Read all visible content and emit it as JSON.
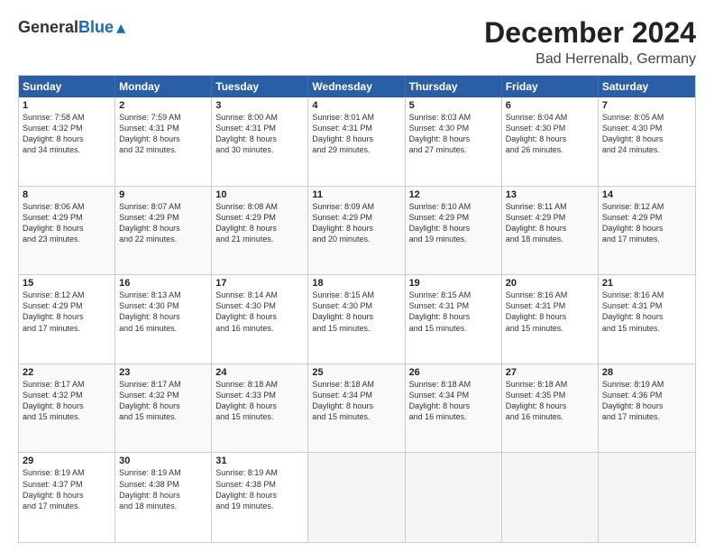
{
  "header": {
    "logo_general": "General",
    "logo_blue": "Blue",
    "title": "December 2024",
    "subtitle": "Bad Herrenalb, Germany"
  },
  "weekdays": [
    "Sunday",
    "Monday",
    "Tuesday",
    "Wednesday",
    "Thursday",
    "Friday",
    "Saturday"
  ],
  "weeks": [
    [
      {
        "day": "1",
        "detail": "Sunrise: 7:58 AM\nSunset: 4:32 PM\nDaylight: 8 hours\nand 34 minutes."
      },
      {
        "day": "2",
        "detail": "Sunrise: 7:59 AM\nSunset: 4:31 PM\nDaylight: 8 hours\nand 32 minutes."
      },
      {
        "day": "3",
        "detail": "Sunrise: 8:00 AM\nSunset: 4:31 PM\nDaylight: 8 hours\nand 30 minutes."
      },
      {
        "day": "4",
        "detail": "Sunrise: 8:01 AM\nSunset: 4:31 PM\nDaylight: 8 hours\nand 29 minutes."
      },
      {
        "day": "5",
        "detail": "Sunrise: 8:03 AM\nSunset: 4:30 PM\nDaylight: 8 hours\nand 27 minutes."
      },
      {
        "day": "6",
        "detail": "Sunrise: 8:04 AM\nSunset: 4:30 PM\nDaylight: 8 hours\nand 26 minutes."
      },
      {
        "day": "7",
        "detail": "Sunrise: 8:05 AM\nSunset: 4:30 PM\nDaylight: 8 hours\nand 24 minutes."
      }
    ],
    [
      {
        "day": "8",
        "detail": "Sunrise: 8:06 AM\nSunset: 4:29 PM\nDaylight: 8 hours\nand 23 minutes."
      },
      {
        "day": "9",
        "detail": "Sunrise: 8:07 AM\nSunset: 4:29 PM\nDaylight: 8 hours\nand 22 minutes."
      },
      {
        "day": "10",
        "detail": "Sunrise: 8:08 AM\nSunset: 4:29 PM\nDaylight: 8 hours\nand 21 minutes."
      },
      {
        "day": "11",
        "detail": "Sunrise: 8:09 AM\nSunset: 4:29 PM\nDaylight: 8 hours\nand 20 minutes."
      },
      {
        "day": "12",
        "detail": "Sunrise: 8:10 AM\nSunset: 4:29 PM\nDaylight: 8 hours\nand 19 minutes."
      },
      {
        "day": "13",
        "detail": "Sunrise: 8:11 AM\nSunset: 4:29 PM\nDaylight: 8 hours\nand 18 minutes."
      },
      {
        "day": "14",
        "detail": "Sunrise: 8:12 AM\nSunset: 4:29 PM\nDaylight: 8 hours\nand 17 minutes."
      }
    ],
    [
      {
        "day": "15",
        "detail": "Sunrise: 8:12 AM\nSunset: 4:29 PM\nDaylight: 8 hours\nand 17 minutes."
      },
      {
        "day": "16",
        "detail": "Sunrise: 8:13 AM\nSunset: 4:30 PM\nDaylight: 8 hours\nand 16 minutes."
      },
      {
        "day": "17",
        "detail": "Sunrise: 8:14 AM\nSunset: 4:30 PM\nDaylight: 8 hours\nand 16 minutes."
      },
      {
        "day": "18",
        "detail": "Sunrise: 8:15 AM\nSunset: 4:30 PM\nDaylight: 8 hours\nand 15 minutes."
      },
      {
        "day": "19",
        "detail": "Sunrise: 8:15 AM\nSunset: 4:31 PM\nDaylight: 8 hours\nand 15 minutes."
      },
      {
        "day": "20",
        "detail": "Sunrise: 8:16 AM\nSunset: 4:31 PM\nDaylight: 8 hours\nand 15 minutes."
      },
      {
        "day": "21",
        "detail": "Sunrise: 8:16 AM\nSunset: 4:31 PM\nDaylight: 8 hours\nand 15 minutes."
      }
    ],
    [
      {
        "day": "22",
        "detail": "Sunrise: 8:17 AM\nSunset: 4:32 PM\nDaylight: 8 hours\nand 15 minutes."
      },
      {
        "day": "23",
        "detail": "Sunrise: 8:17 AM\nSunset: 4:32 PM\nDaylight: 8 hours\nand 15 minutes."
      },
      {
        "day": "24",
        "detail": "Sunrise: 8:18 AM\nSunset: 4:33 PM\nDaylight: 8 hours\nand 15 minutes."
      },
      {
        "day": "25",
        "detail": "Sunrise: 8:18 AM\nSunset: 4:34 PM\nDaylight: 8 hours\nand 15 minutes."
      },
      {
        "day": "26",
        "detail": "Sunrise: 8:18 AM\nSunset: 4:34 PM\nDaylight: 8 hours\nand 16 minutes."
      },
      {
        "day": "27",
        "detail": "Sunrise: 8:18 AM\nSunset: 4:35 PM\nDaylight: 8 hours\nand 16 minutes."
      },
      {
        "day": "28",
        "detail": "Sunrise: 8:19 AM\nSunset: 4:36 PM\nDaylight: 8 hours\nand 17 minutes."
      }
    ],
    [
      {
        "day": "29",
        "detail": "Sunrise: 8:19 AM\nSunset: 4:37 PM\nDaylight: 8 hours\nand 17 minutes."
      },
      {
        "day": "30",
        "detail": "Sunrise: 8:19 AM\nSunset: 4:38 PM\nDaylight: 8 hours\nand 18 minutes."
      },
      {
        "day": "31",
        "detail": "Sunrise: 8:19 AM\nSunset: 4:38 PM\nDaylight: 8 hours\nand 19 minutes."
      },
      {
        "day": "",
        "detail": ""
      },
      {
        "day": "",
        "detail": ""
      },
      {
        "day": "",
        "detail": ""
      },
      {
        "day": "",
        "detail": ""
      }
    ]
  ]
}
